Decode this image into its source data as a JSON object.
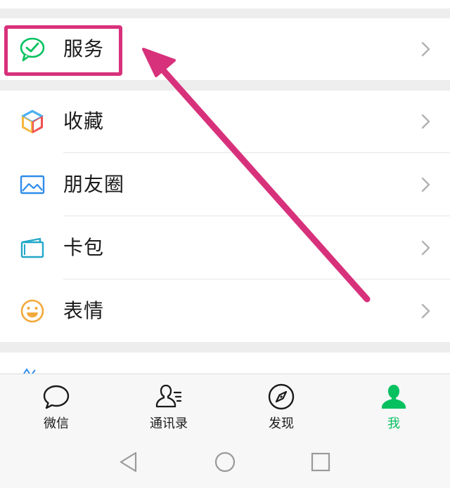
{
  "menu": {
    "service": {
      "label": "服务",
      "icon": "wechat-pay-icon"
    },
    "items": [
      {
        "label": "收藏",
        "icon": "cube-icon"
      },
      {
        "label": "朋友圈",
        "icon": "photo-album-icon"
      },
      {
        "label": "卡包",
        "icon": "card-wallet-icon"
      },
      {
        "label": "表情",
        "icon": "smiley-face-icon"
      }
    ]
  },
  "tabbar": {
    "tabs": [
      {
        "label": "微信",
        "icon": "chat-bubble-icon",
        "active": false
      },
      {
        "label": "通讯录",
        "icon": "contacts-icon",
        "active": false
      },
      {
        "label": "发现",
        "icon": "compass-icon",
        "active": false
      },
      {
        "label": "我",
        "icon": "person-icon",
        "active": true
      }
    ]
  },
  "colors": {
    "accent_green": "#07c160",
    "highlight_pink": "#d8317b",
    "background": "#ededed",
    "chevron": "#b2b2b2"
  },
  "system_nav": {
    "buttons": [
      "back-triangle-icon",
      "home-circle-icon",
      "recents-square-icon"
    ]
  }
}
